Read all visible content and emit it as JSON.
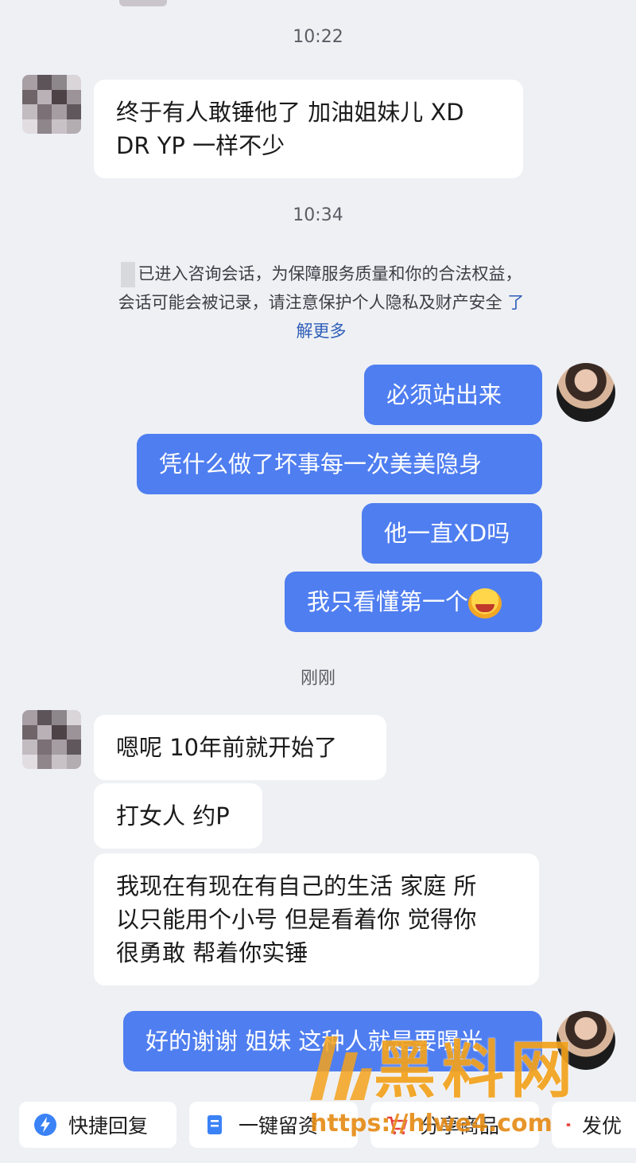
{
  "timestamps": [
    "10:22",
    "10:34",
    "刚刚"
  ],
  "messages": {
    "m1": "终于有人敢锤他了 加油姐妹儿 XD",
    "m1b": "DR YP 一样不少",
    "m2": "必须站出来",
    "m3": "凭什么做了坏事每一次美美隐身",
    "m4": "他一直XD吗",
    "m5": "我只看懂第一个",
    "m6": "嗯呢 10年前就开始了",
    "m7": "打女人 约P",
    "m8a": "我现在有现在有自己的生活 家庭 所",
    "m8b": "以只能用个小号 但是看着你 觉得你",
    "m8c": "很勇敢 帮着你实锤",
    "m9": "好的谢谢 姐妹 这种人就是要曝光"
  },
  "system": {
    "line1": "已进入咨询会话，为保障服务质量和你的合法权益，",
    "line2": "会话可能会被记录，请注意保护个人隐私及财产安全",
    "link1": "了",
    "link2": "解更多"
  },
  "toolbar": {
    "quick_reply": "快捷回复",
    "leave_msg": "一键留资",
    "share_goods": "分享商品",
    "send": "发优"
  },
  "watermark": {
    "title": "黑料网",
    "url": "https://hlwe4.com"
  },
  "colors": {
    "outgoing": "#4f7ef0",
    "incoming": "#ffffff",
    "background": "#eef0f4",
    "link": "#2f5fb8",
    "watermark": "#f3a21c"
  }
}
